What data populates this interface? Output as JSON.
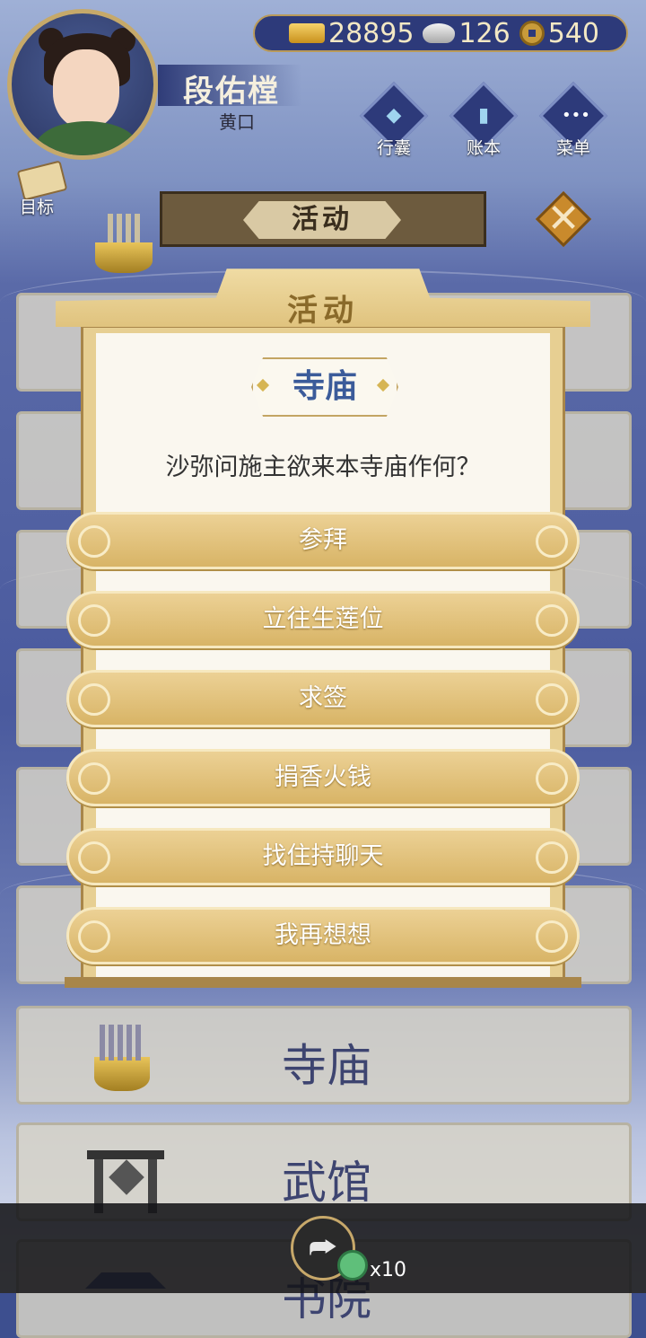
{
  "header": {
    "player_name": "段佑樘",
    "player_title": "黄口",
    "currencies": [
      {
        "icon": "gold-ingot-icon",
        "value": "28895"
      },
      {
        "icon": "silver-ingot-icon",
        "value": "126"
      },
      {
        "icon": "copper-coin-icon",
        "value": "540"
      }
    ],
    "menu_buttons": [
      {
        "icon": "bag-icon",
        "label": "行囊"
      },
      {
        "icon": "ledger-icon",
        "label": "账本"
      },
      {
        "icon": "menu-dots-icon",
        "label": "菜单"
      }
    ],
    "target_label": "目标",
    "banner_title": "活动"
  },
  "background_list": [
    {
      "label": "寺庙",
      "icon": "censer-icon"
    },
    {
      "label": "武馆",
      "icon": "gate-icon"
    },
    {
      "label": "书院",
      "icon": "pavilion-icon"
    }
  ],
  "modal": {
    "title": "活动",
    "place": "寺庙",
    "question": "沙弥问施主欲来本寺庙作何？",
    "options": [
      "参拜",
      "立往生莲位",
      "求签",
      "捐香火钱",
      "找住持聊天",
      "我再想想"
    ]
  },
  "bottom": {
    "share_icon": "share-icon",
    "reward_icon": "jade-icon",
    "reward_count": "x10"
  }
}
